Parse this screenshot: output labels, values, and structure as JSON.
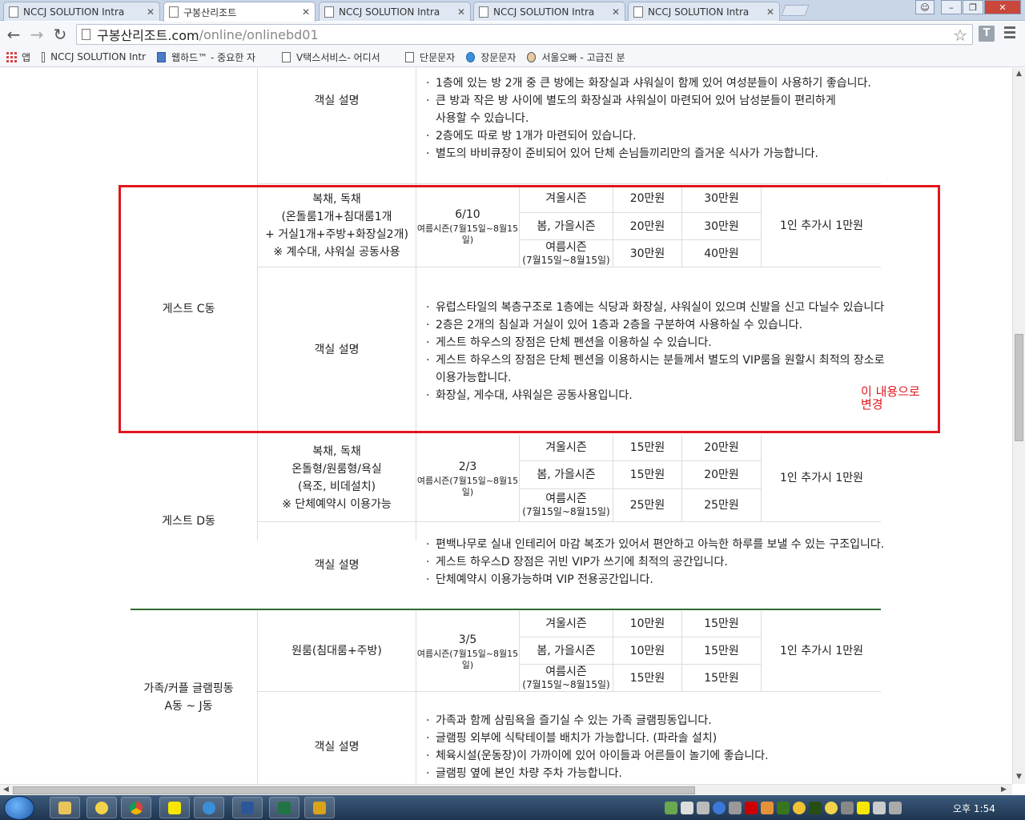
{
  "browser": {
    "tabs": [
      {
        "label": "NCCJ SOLUTION Intra",
        "active": false
      },
      {
        "label": "구봉산리조트",
        "active": true
      },
      {
        "label": "NCCJ SOLUTION Intra",
        "active": false
      },
      {
        "label": "NCCJ SOLUTION Intra",
        "active": false
      },
      {
        "label": "NCCJ SOLUTION Intra",
        "active": false
      }
    ],
    "url_host": "구봉산리조트.com",
    "url_path": "/online/onlinebd01",
    "extension_label": "T",
    "bookmarks": {
      "apps": "앱",
      "items": [
        "NCCJ SOLUTION Intr",
        "웹하드™ - 중요한 자",
        "V택스서비스- 어디서",
        "단문문자",
        "장문문자",
        "서울오빠 - 고급진 분"
      ]
    }
  },
  "top_section": {
    "room_type_label": "객실 설명",
    "desc_lines": [
      {
        "text": "1층에 있는 방 2개 중 큰 방에는 화장실과 샤워실이 함께 있어 여성분들이 사용하기 좋습니다.",
        "bullet": true
      },
      {
        "text": "큰 방과 작은 방 사이에 별도의 화장실과 샤워실이 마련되어 있어 남성분들이 편리하게",
        "bullet": true
      },
      {
        "text": "사용할 수 있습니다.",
        "bullet": false
      },
      {
        "text": "2층에도 따로 방 1개가 마련되어 있습니다.",
        "bullet": true
      },
      {
        "text": "별도의 바비큐장이 준비되어 있어 단체 손님들끼리만의 즐거운 식사가 가능합니다.",
        "bullet": true
      }
    ]
  },
  "rooms": [
    {
      "name": "게스트 C동",
      "type_lines": [
        "복채, 독채",
        "(온돌룸1개+침대룸1개",
        "+ 거실1개+주방+화장실2개)",
        "※ 계수대, 샤워실 공동사용"
      ],
      "capacity": "6/10",
      "capacity_note": "여름시즌(7월15일~8월15일)",
      "seasons": [
        {
          "name": "겨울시즌",
          "sub": "",
          "weekday": "20만원",
          "weekend": "30만원"
        },
        {
          "name": "봄, 가을시즌",
          "sub": "",
          "weekday": "20만원",
          "weekend": "30만원"
        },
        {
          "name": "여름시즌",
          "sub": "(7월15일~8월15일)",
          "weekday": "30만원",
          "weekend": "40만원"
        }
      ],
      "extra": "1인 추가시 1만원",
      "desc_label": "객실 설명",
      "desc_lines": [
        {
          "text": "유럽스타일의 복층구조로 1층에는 식당과 화장실, 샤워실이 있으며 신발을 신고 다닐수 있습니다",
          "bullet": true
        },
        {
          "text": "2층은 2개의 침실과 거실이 있어 1층과 2층을 구분하여 사용하실 수 있습니다.",
          "bullet": true
        },
        {
          "text": "게스트 하우스의 장점은 단체 펜션을 이용하실 수 있습니다.",
          "bullet": true
        },
        {
          "text": "게스트 하우스의 장점은 단체 펜션을 이용하시는 분들께서 별도의 VIP룸을 원할시 최적의 장소로",
          "bullet": true
        },
        {
          "text": "이용가능합니다.",
          "bullet": false
        },
        {
          "text": "화장실, 게수대, 샤워실은 공동사용입니다.",
          "bullet": true
        }
      ]
    },
    {
      "name": "게스트 D동",
      "type_lines": [
        "복채, 독채",
        "온돌형/원룸형/욕실",
        "(욕조, 비데설치)",
        "※ 단체예약시 이용가능"
      ],
      "capacity": "2/3",
      "capacity_note": "여름시즌(7월15일~8월15일)",
      "seasons": [
        {
          "name": "겨울시즌",
          "sub": "",
          "weekday": "15만원",
          "weekend": "20만원"
        },
        {
          "name": "봄, 가을시즌",
          "sub": "",
          "weekday": "15만원",
          "weekend": "20만원"
        },
        {
          "name": "여름시즌",
          "sub": "(7월15일~8월15일)",
          "weekday": "25만원",
          "weekend": "25만원"
        }
      ],
      "extra": "1인 추가시 1만원",
      "desc_label": "객실 설명",
      "desc_lines": [
        {
          "text": "편백나무로 실내 인테리어 마감 복조가 있어서 편안하고 아늑한 하루를 보낼 수 있는 구조입니다.",
          "bullet": true
        },
        {
          "text": "게스트 하우스D 장점은 귀빈 VIP가 쓰기에 최적의 공간입니다.",
          "bullet": true
        },
        {
          "text": "단체예약시 이용가능하며 VIP 전용공간입니다.",
          "bullet": true
        }
      ]
    },
    {
      "name_lines": [
        "가족/커플 글램핑동",
        "A동 ~ J동"
      ],
      "type_lines": [
        "원룸(침대룸+주방)"
      ],
      "capacity": "3/5",
      "capacity_note": "여름시즌(7월15일~8월15일)",
      "seasons": [
        {
          "name": "겨울시즌",
          "sub": "",
          "weekday": "10만원",
          "weekend": "15만원"
        },
        {
          "name": "봄, 가을시즌",
          "sub": "",
          "weekday": "10만원",
          "weekend": "15만원"
        },
        {
          "name": "여름시즌",
          "sub": "(7월15일~8월15일)",
          "weekday": "15만원",
          "weekend": "15만원"
        }
      ],
      "extra": "1인 추가시 1만원",
      "desc_label": "객실 설명",
      "desc_lines": [
        {
          "text": "가족과 함께 삼림욕을 즐기실 수 있는 가족 글램핑동입니다.",
          "bullet": true
        },
        {
          "text": "글램핑 외부에 식탁테이블 배치가 가능합니다. (파라솔 설치)",
          "bullet": true
        },
        {
          "text": "체육시설(운동장)이 가까이에 있어 아이들과 어른들이 놀기에 좋습니다.",
          "bullet": true
        },
        {
          "text": "글램핑 옆에 본인 차량 주차 가능합니다.",
          "bullet": true
        }
      ]
    }
  ],
  "annotation": {
    "line1": "이 내용으로",
    "line2": "변경"
  },
  "taskbar": {
    "clock": "오후 1:54"
  },
  "colors": {
    "highlight": "#e0161c",
    "divider": "#2e6b2e"
  }
}
